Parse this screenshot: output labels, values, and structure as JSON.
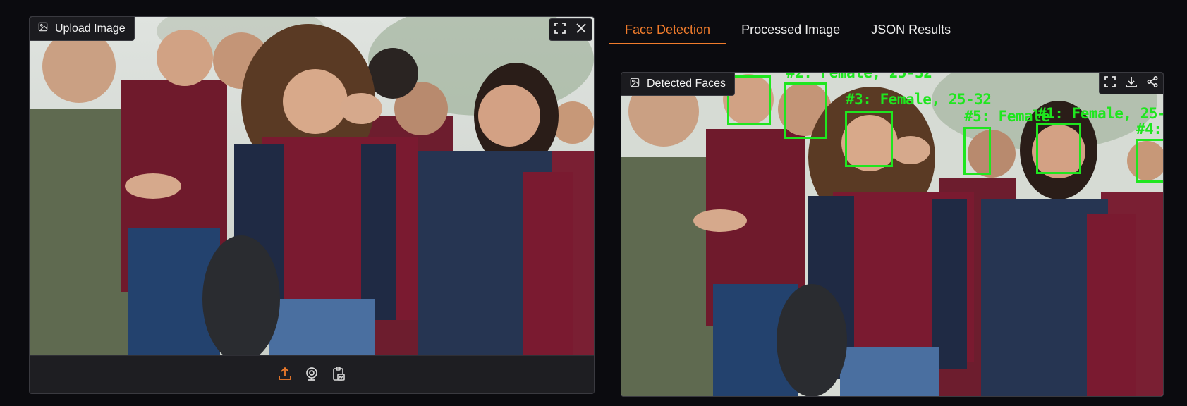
{
  "upload": {
    "label": "Upload Image",
    "icon": "image-icon",
    "tools": [
      "fullscreen-icon",
      "close-icon"
    ],
    "sources": [
      "upload-icon",
      "webcam-icon",
      "clipboard-icon"
    ],
    "accent": "#f07c2c"
  },
  "tabs": [
    {
      "label": "Face Detection",
      "active": true
    },
    {
      "label": "Processed Image",
      "active": false
    },
    {
      "label": "JSON Results",
      "active": false
    }
  ],
  "result": {
    "label": "Detected Faces",
    "tools": [
      "fullscreen-icon",
      "download-icon",
      "share-icon"
    ],
    "box_color": "#1fe61f",
    "detections": [
      {
        "text": "#2: Female, 25-32"
      },
      {
        "text": "#3: Female, 25-32"
      },
      {
        "text": "#5: Female"
      },
      {
        "text": "#1: Female, 25-"
      },
      {
        "text": "#4:"
      }
    ]
  }
}
